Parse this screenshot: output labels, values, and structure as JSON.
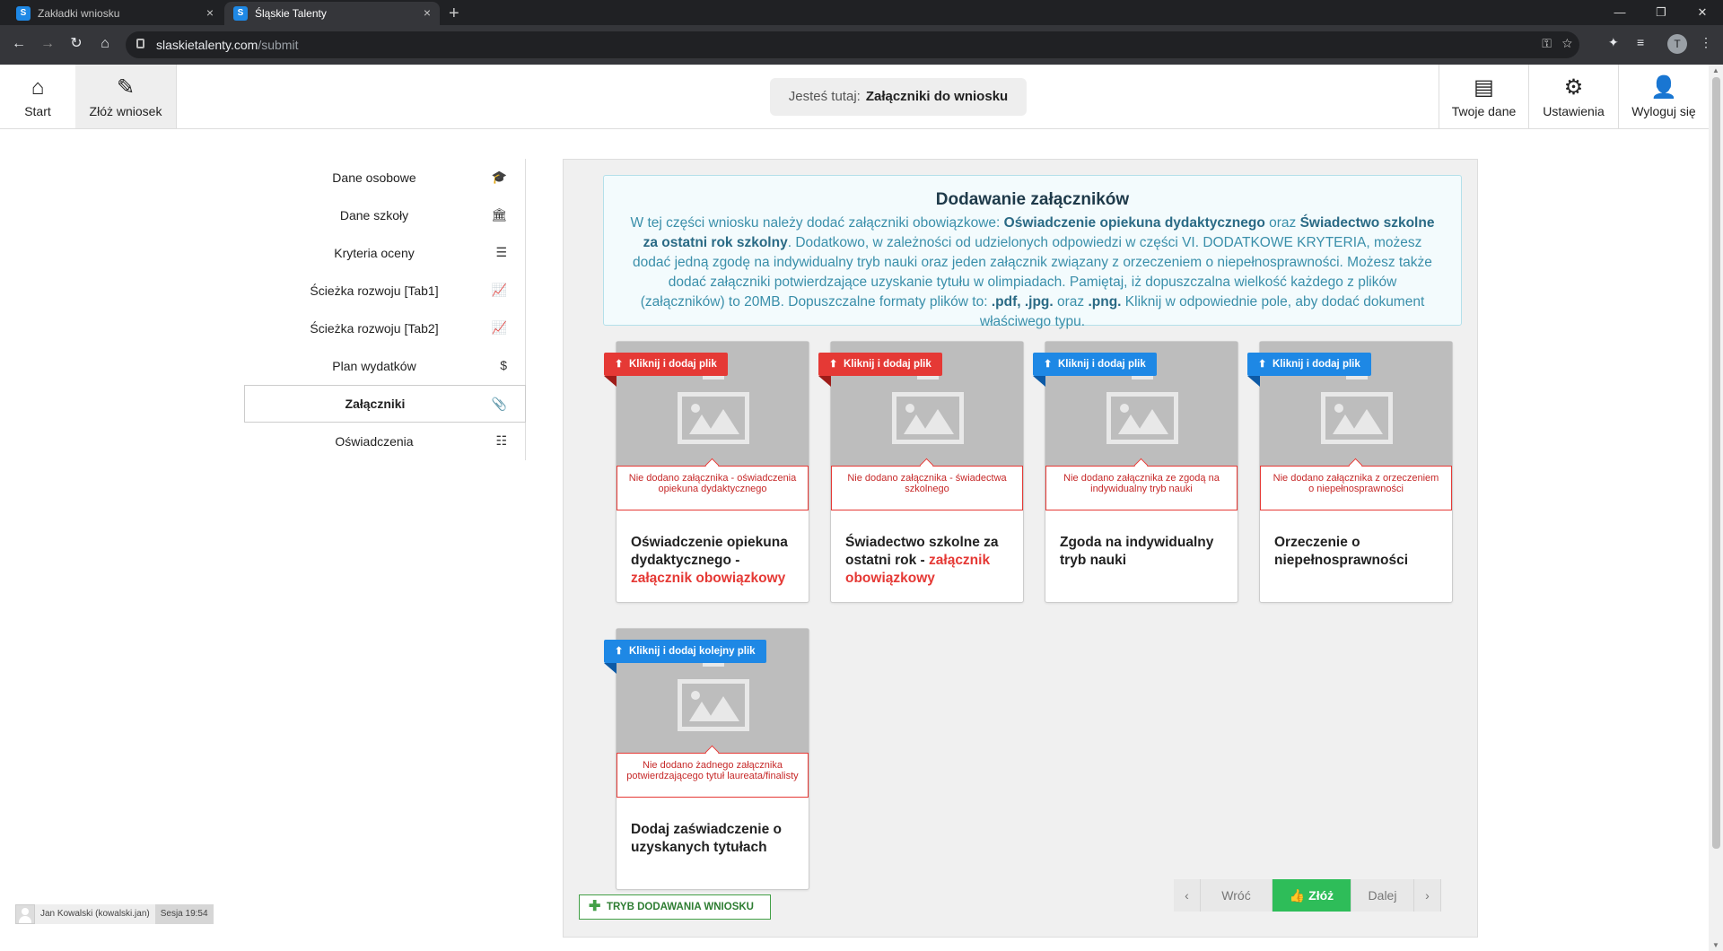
{
  "browser": {
    "tabs": [
      {
        "favicon": "S",
        "title": "Zakładki wniosku",
        "close": "×"
      },
      {
        "favicon": "S",
        "title": "Śląskie Talenty",
        "close": "×"
      }
    ],
    "new_tab": "+",
    "window_controls": [
      "—",
      "❐",
      "✕"
    ],
    "url_domain": "slaskietalenty.com",
    "url_path": "/submit",
    "profile_initial": "T"
  },
  "header": {
    "start_label": "Start",
    "submit_label": "Złóż wniosek",
    "breadcrumb_prefix": "Jesteś tutaj:",
    "breadcrumb_current": "Załączniki do wniosku",
    "mydata_label": "Twoje dane",
    "settings_label": "Ustawienia",
    "logout_label": "Wyloguj się"
  },
  "sidebar": {
    "items": [
      {
        "label": "Dane osobowe",
        "icon": "graduation-cap-icon",
        "glyph": "🎓"
      },
      {
        "label": "Dane szkoły",
        "icon": "institution-icon",
        "glyph": "🏛"
      },
      {
        "label": "Kryteria oceny",
        "icon": "list-lines-icon",
        "glyph": "☰"
      },
      {
        "label": "Ścieżka rozwoju [Tab1]",
        "icon": "line-chart-icon",
        "glyph": "📈"
      },
      {
        "label": "Ścieżka rozwoju [Tab2]",
        "icon": "line-chart-icon",
        "glyph": "📈"
      },
      {
        "label": "Plan wydatków",
        "icon": "dollar-icon",
        "glyph": "$"
      },
      {
        "label": "Załączniki",
        "icon": "paperclip-icon",
        "glyph": "📎",
        "active": true
      },
      {
        "label": "Oświadczenia",
        "icon": "checklist-icon",
        "glyph": "☷"
      }
    ]
  },
  "info": {
    "title": "Dodawanie załączników",
    "p1": "W tej części wniosku należy dodać załączniki obowiązkowe: ",
    "b1": "Oświadczenie opiekuna dydaktycznego",
    "p2": " oraz ",
    "b2": "Świadectwo szkolne za ostatni rok szkolny",
    "p3": ". Dodatkowo, w zależności od udzielonych odpowiedzi w części VI. DODATKOWE KRYTERIA, możesz dodać jedną zgodę na indywidualny tryb nauki oraz jeden załącznik związany z orzeczeniem o niepełnosprawności. Możesz także dodać załączniki potwierdzające uzyskanie tytułu w olimpiadach. Pamiętaj, iż dopuszczalna wielkość każdego z plików (załączników) to 20MB. Dopuszczalne formaty plików to: ",
    "b3": ".pdf, .jpg.",
    "p4": " oraz ",
    "b4": ".png.",
    "p5": " Kliknij w odpowiednie pole, aby dodać dokument właściwego typu."
  },
  "cards": [
    {
      "ribbon": "Kliknij i dodaj plik",
      "ribbon_color": "#e53935",
      "error": "Nie dodano załącznika - oświadczenia opiekuna dydaktycznego",
      "title": "Oświadczenie opiekuna dydaktycznego - ",
      "required": "załącznik obowiązkowy"
    },
    {
      "ribbon": "Kliknij i dodaj plik",
      "ribbon_color": "#e53935",
      "error": "Nie dodano załącznika - świadectwa szkolnego",
      "title": "Świadectwo szkolne za ostatni rok - ",
      "required": "załącznik obowiązkowy"
    },
    {
      "ribbon": "Kliknij i dodaj plik",
      "ribbon_color": "#1e88e5",
      "error": "Nie dodano załącznika ze zgodą na indywidualny tryb nauki",
      "title": "Zgoda na indywidualny tryb nauki",
      "required": ""
    },
    {
      "ribbon": "Kliknij i dodaj plik",
      "ribbon_color": "#1e88e5",
      "error": "Nie dodano załącznika z orzeczeniem o niepełnosprawności",
      "title": "Orzeczenie o niepełnosprawności",
      "required": ""
    },
    {
      "ribbon": "Kliknij i dodaj kolejny plik",
      "ribbon_color": "#1e88e5",
      "error": "Nie dodano żadnego załącznika potwierdzającego tytuł laureata/finalisty",
      "title": "Dodaj zaświadczenie o uzyskanych tytułach",
      "required": ""
    }
  ],
  "mode_button": "TRYB DODAWANIA WNIOSKU",
  "pager": {
    "prev_arrow": "‹",
    "back": "Wróć",
    "submit": "Złóż",
    "next": "Dalej",
    "next_arrow": "›"
  },
  "session": {
    "user": "Jan Kowalski (kowalski.jan)",
    "time": "Sesja 19:54"
  },
  "colors": {
    "required_red": "#e53935",
    "optional_blue": "#1e88e5",
    "submit_green": "#2ebd59"
  }
}
